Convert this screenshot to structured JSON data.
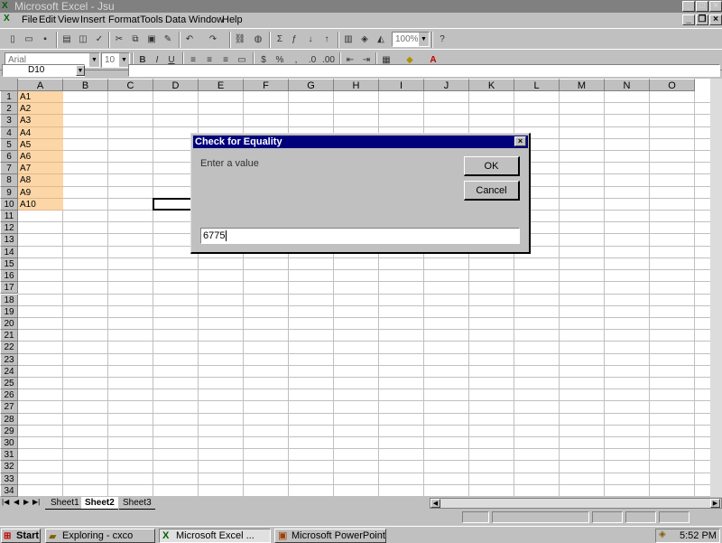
{
  "window": {
    "title": "Microsoft Excel - Jsu"
  },
  "menu": [
    "File",
    "Edit",
    "View",
    "Insert",
    "Format",
    "Tools",
    "Data",
    "Window",
    "Help"
  ],
  "toolbar": {
    "zoom": "100%",
    "font": "Arial",
    "size": "10"
  },
  "name_box": "D10",
  "columns": [
    "A",
    "B",
    "C",
    "D",
    "E",
    "F",
    "G",
    "H",
    "I",
    "J",
    "K",
    "L",
    "M",
    "N",
    "O"
  ],
  "rows": [
    "1",
    "2",
    "3",
    "4",
    "5",
    "6",
    "7",
    "8",
    "9",
    "10",
    "11",
    "12",
    "13",
    "14",
    "15",
    "16",
    "17",
    "18",
    "19",
    "20",
    "21",
    "22",
    "23",
    "24",
    "25",
    "26",
    "27",
    "28",
    "29",
    "30",
    "31",
    "32",
    "33",
    "34"
  ],
  "cells_a": [
    "A1",
    "A2",
    "A3",
    "A4",
    "A5",
    "A6",
    "A7",
    "A8",
    "A9",
    "A10"
  ],
  "sheets": [
    "Sheet1",
    "Sheet2",
    "Sheet3"
  ],
  "dialog": {
    "title": "Check for Equality",
    "prompt": "Enter a value",
    "ok": "OK",
    "cancel": "Cancel",
    "input_value": "6775"
  },
  "taskbar": {
    "start": "Start",
    "tasks": [
      "Exploring - cxco",
      "Microsoft Excel ...",
      "Microsoft PowerPoint..."
    ],
    "clock": "5:52 PM"
  }
}
